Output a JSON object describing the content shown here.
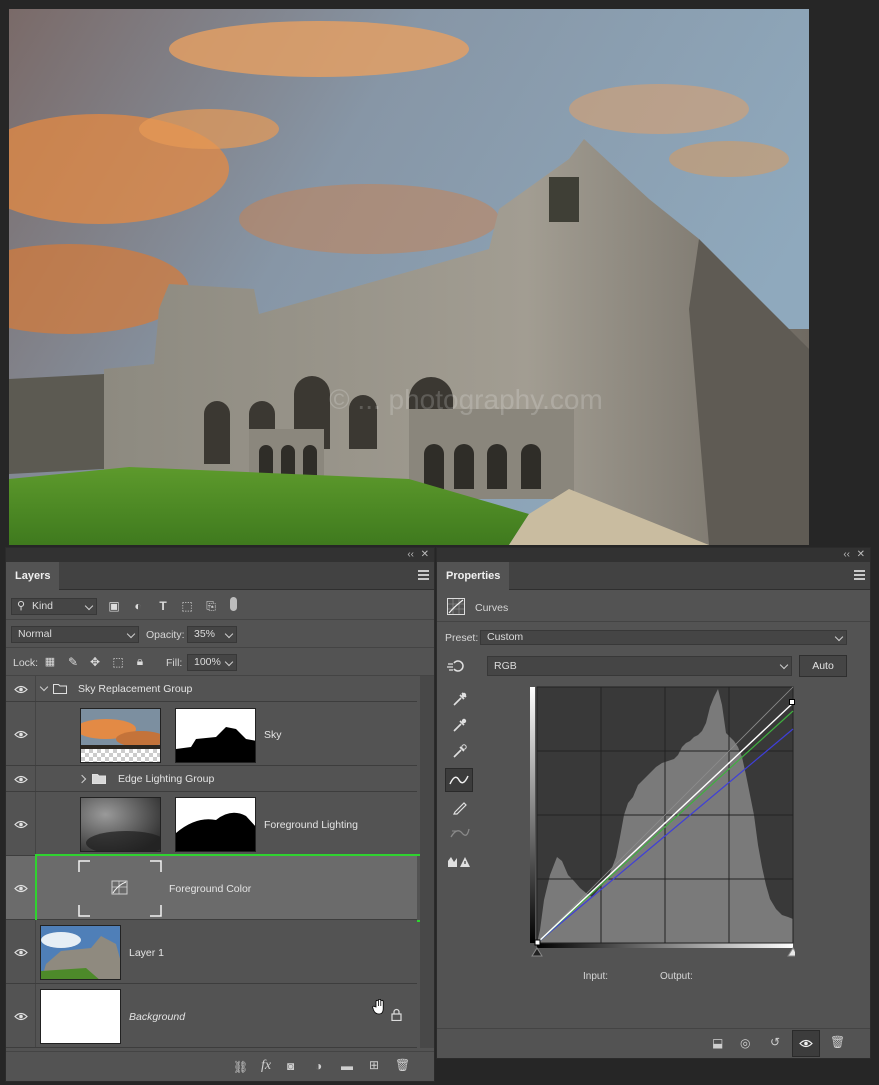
{
  "canvas": {
    "watermark": "© ... photography.com",
    "sky_colors": [
      "#6f8fa6",
      "#e98a3d"
    ]
  },
  "layers_panel": {
    "tab": "Layers",
    "filter_kind": "Kind",
    "blend_mode": "Normal",
    "opacity_label": "Opacity:",
    "opacity_value": "35%",
    "lock_label": "Lock:",
    "fill_label": "Fill:",
    "fill_value": "100%",
    "filter_icons": [
      "image-filter-icon",
      "adjustment-filter-icon",
      "type-filter-icon",
      "shape-filter-icon",
      "smart-object-filter-icon",
      "filter-toggle-icon"
    ],
    "lock_icons": [
      "lock-transparent-icon",
      "lock-paint-icon",
      "lock-position-icon",
      "lock-artboard-icon",
      "lock-all-icon"
    ],
    "layers": [
      {
        "name": "Sky Replacement Group",
        "kind": "group",
        "expanded": true
      },
      {
        "name": "Sky",
        "kind": "layer-with-mask"
      },
      {
        "name": "Edge Lighting Group",
        "kind": "group",
        "expanded": false
      },
      {
        "name": "Foreground Lighting",
        "kind": "layer-with-mask"
      },
      {
        "name": "Foreground Color",
        "kind": "adjustment",
        "selected": true
      },
      {
        "name": "Layer 1",
        "kind": "pixel"
      },
      {
        "name": "Background",
        "kind": "background",
        "locked": true
      }
    ],
    "footer_icons": [
      "link-layers-icon",
      "fx-icon",
      "add-mask-icon",
      "new-adjustment-icon",
      "new-group-icon",
      "new-layer-icon",
      "delete-layer-icon"
    ],
    "fx_label": "fx"
  },
  "properties_panel": {
    "tab": "Properties",
    "adjustment_title": "Curves",
    "preset_label": "Preset:",
    "preset_value": "Custom",
    "channel_value": "RGB",
    "auto_button": "Auto",
    "tools": [
      "on-image-adjust-icon",
      "black-point-eyedropper-icon",
      "gray-point-eyedropper-icon",
      "white-point-eyedropper-icon",
      "curve-points-icon",
      "pencil-draw-icon",
      "smooth-curve-icon",
      "clipping-warning-icon"
    ],
    "input_label": "Input:",
    "output_label": "Output:",
    "footer_icons": [
      "clip-to-layer-icon",
      "view-previous-icon",
      "reset-icon",
      "visibility-icon",
      "delete-icon"
    ]
  }
}
